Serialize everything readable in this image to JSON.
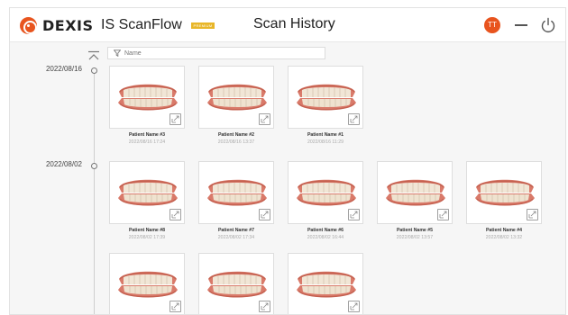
{
  "header": {
    "brand": "DEXIS",
    "product": "IS ScanFlow",
    "badge": "PREMIUM",
    "title": "Scan History",
    "avatar_initials": "TT",
    "accent": "#e8541e",
    "badge_color": "#e8b628"
  },
  "filter": {
    "placeholder": "Name",
    "value": ""
  },
  "groups": [
    {
      "date": "2022/08/16",
      "scans": [
        {
          "name": "Patient Name #3",
          "datetime": "2022/08/16 17:24"
        },
        {
          "name": "Patient Name #2",
          "datetime": "2022/08/16 13:37"
        },
        {
          "name": "Patient Name #1",
          "datetime": "2022/08/16 11:29"
        }
      ]
    },
    {
      "date": "2022/08/02",
      "scans": [
        {
          "name": "Patient Name #8",
          "datetime": "2022/08/02 17:39"
        },
        {
          "name": "Patient Name #7",
          "datetime": "2022/08/02 17:34"
        },
        {
          "name": "Patient Name #6",
          "datetime": "2022/08/02 16:44"
        },
        {
          "name": "Patient Name #5",
          "datetime": "2022/08/02 13:57"
        },
        {
          "name": "Patient Name #4",
          "datetime": "2022/08/02 13:32"
        }
      ]
    }
  ],
  "icons": {
    "logo": "dexis-logo-icon",
    "scroll_top": "chevron-up-bar-icon",
    "filter": "funnel-icon",
    "minimize": "minimize-icon",
    "power": "power-icon",
    "open_scan": "open-external-icon"
  }
}
